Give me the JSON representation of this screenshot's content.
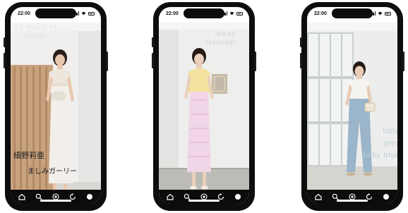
{
  "phones": [
    {
      "status": {
        "time": "22:00"
      },
      "overlay": {
        "line1": "51 stack of",
        "line2": "cream",
        "name": "細野莉亜",
        "style": "ましみガーリー"
      },
      "colors": {
        "overlay": "#e3e3e3",
        "caption": "#1e1e1e"
      }
    },
    {
      "status": {
        "time": "22:00"
      },
      "overlay": {
        "line1": "lemon",
        "line2": "lavender"
      },
      "colors": {
        "overlay": "#cfcfcf"
      }
    },
    {
      "status": {
        "time": "22:00"
      },
      "overlay": {
        "line1": "little",
        "line2": "grey",
        "line3": "baby blue"
      },
      "colors": {
        "overlay": "#b9ced8"
      }
    }
  ],
  "navbar": {
    "icons": [
      "home-icon",
      "search-icon",
      "camera-icon",
      "refresh-icon",
      "profile-icon"
    ]
  }
}
